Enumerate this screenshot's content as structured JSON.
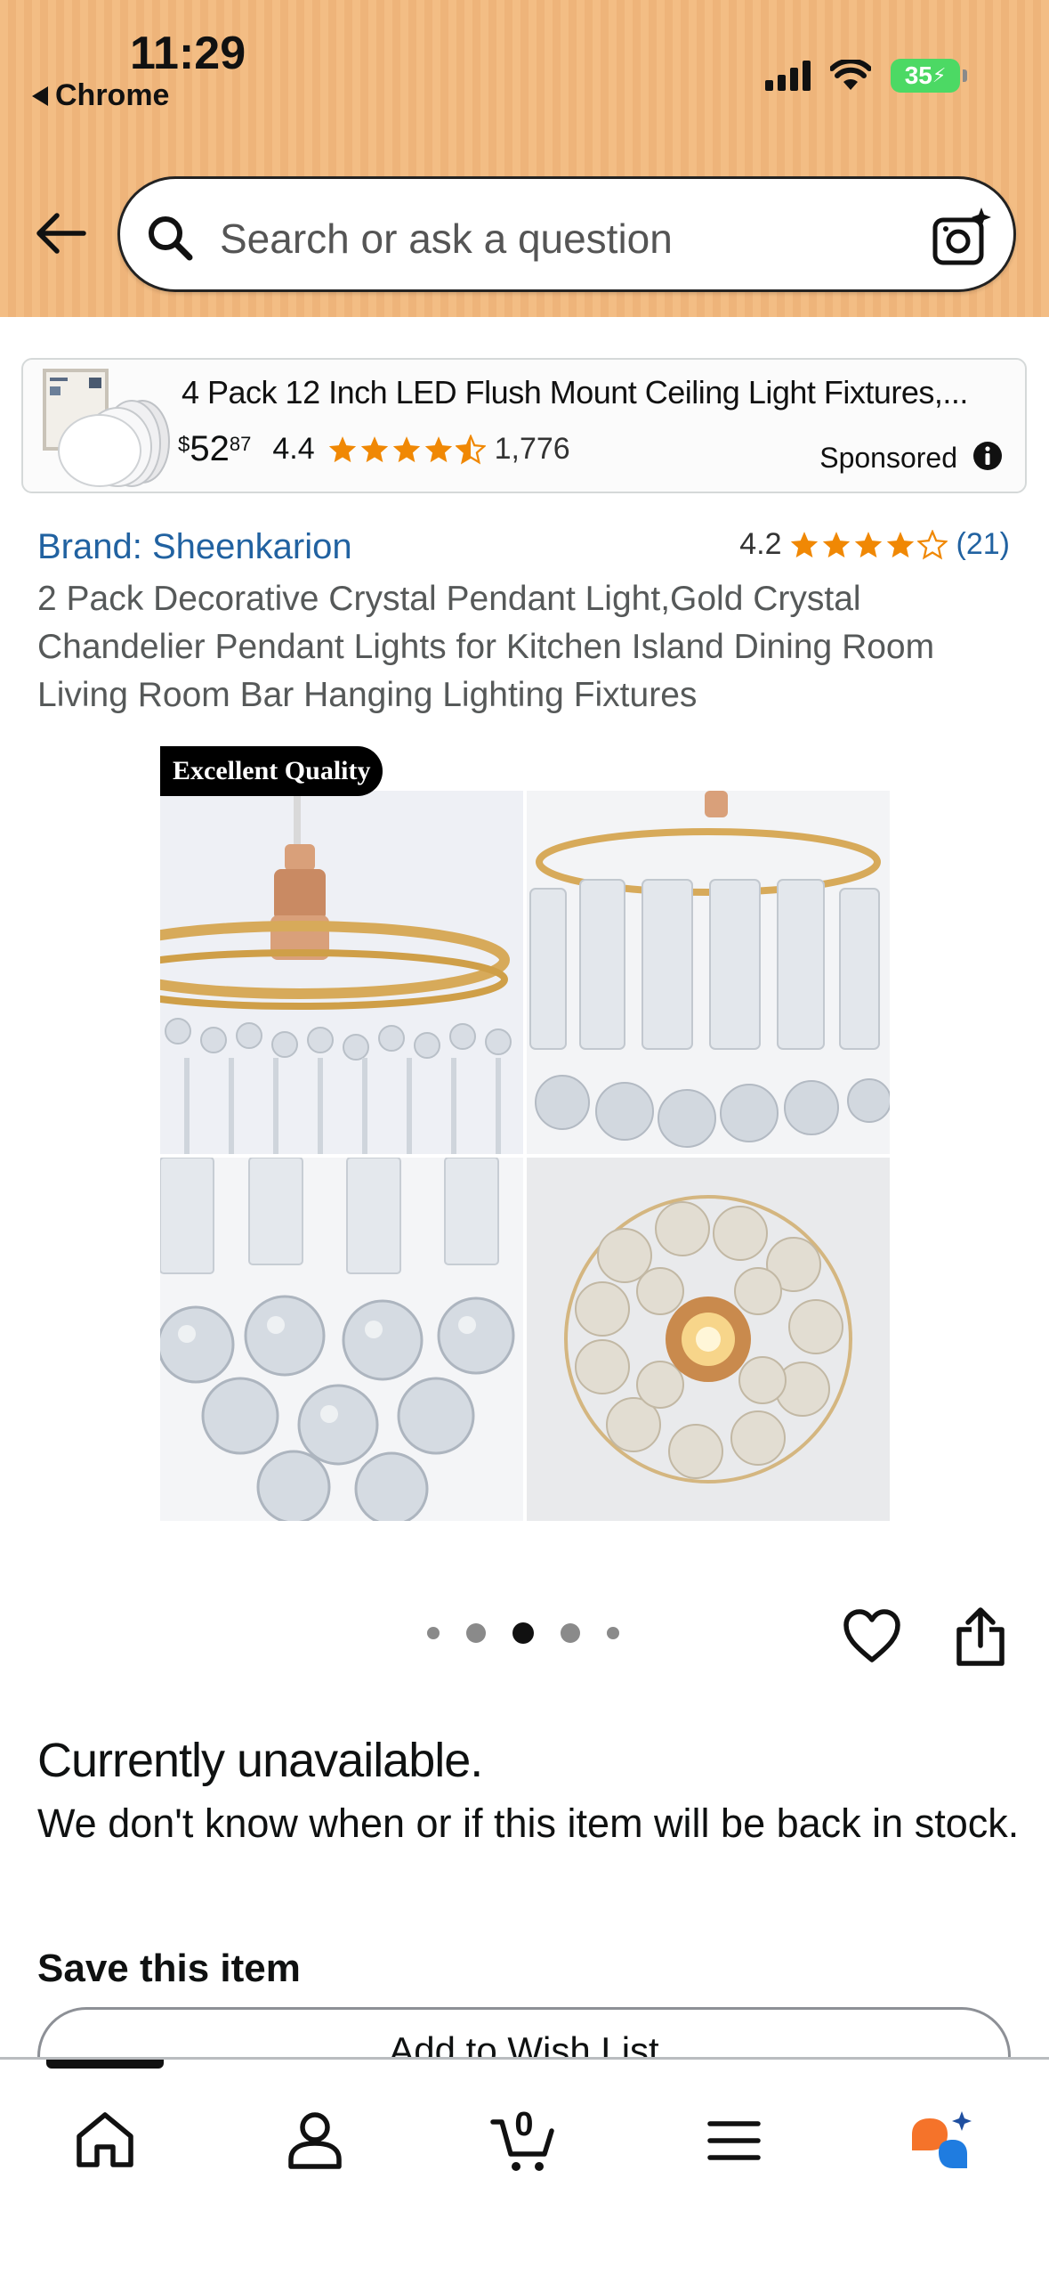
{
  "status_bar": {
    "time": "11:29",
    "back_app": "Chrome",
    "battery": "35"
  },
  "search": {
    "placeholder": "Search or ask a question"
  },
  "sponsored": {
    "title": "4 Pack 12 Inch LED Flush Mount Ceiling Light Fixtures,...",
    "price_symbol": "$",
    "price_whole": "52",
    "price_fraction": "87",
    "rating": "4.4",
    "rating_stars": 4.5,
    "review_count": "1,776",
    "label": "Sponsored"
  },
  "product": {
    "brand": "Brand: Sheenkarion",
    "rating": "4.2",
    "rating_stars": 4,
    "review_count": "(21)",
    "title": "2 Pack Decorative Crystal Pendant Light,Gold Crystal Chandelier Pendant Lights for Kitchen Island Dining Room Living Room Bar Hanging Lighting Fixtures",
    "image_badge": "Excellent Quality"
  },
  "carousel": {
    "count": 5,
    "active_index": 2
  },
  "availability": {
    "title": "Currently unavailable.",
    "description": "We don't know when or if this item will be back in stock."
  },
  "save": {
    "heading": "Save this item",
    "wishlist_label": "Add to Wish List"
  },
  "tabbar": {
    "cart_count": "0",
    "tabs": [
      "home-icon",
      "account-icon",
      "cart-icon",
      "menu-icon",
      "rufus-icon"
    ]
  },
  "colors": {
    "header_bg": "#f3bd84",
    "link": "#2162a1",
    "star": "#f08804",
    "battery": "#4cd964"
  }
}
